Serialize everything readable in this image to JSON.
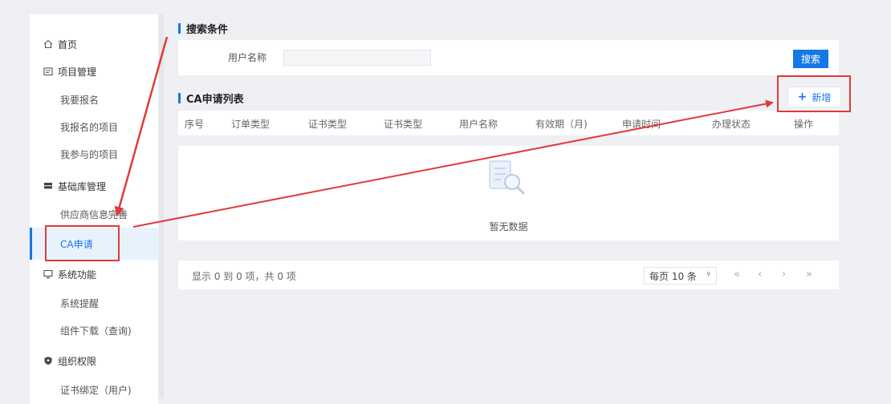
{
  "sidebar": {
    "home": "首页",
    "project_mgmt": "项目管理",
    "project_items": [
      "我要报名",
      "我报名的项目",
      "我参与的项目"
    ],
    "base_mgmt": "基础库管理",
    "base_items": [
      "供应商信息完善",
      "CA申请"
    ],
    "system": "系统功能",
    "system_items": [
      "系统提醒",
      "组件下载（查询)"
    ],
    "org": "组织权限",
    "org_items": [
      "证书绑定（用户)"
    ]
  },
  "search": {
    "title": "搜索条件",
    "user_label": "用户名称",
    "user_value": "",
    "button": "搜索"
  },
  "list": {
    "title": "CA申请列表",
    "add_button": "新增",
    "columns": [
      "序号",
      "订单类型",
      "证书类型",
      "证书类型",
      "用户名称",
      "有效期（月)",
      "申请时间",
      "办理状态",
      "操作"
    ],
    "empty_text": "暂无数据"
  },
  "pager": {
    "info": "显示 0 到 0 项，共 0 项",
    "page_size": "每页 10 条",
    "first": "«",
    "prev": "‹",
    "next": "›",
    "last": "»"
  },
  "colors": {
    "accent": "#1677e6",
    "annotation": "#e03a3a"
  }
}
